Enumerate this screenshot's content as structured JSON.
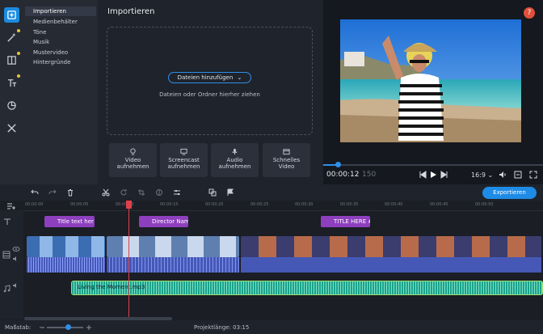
{
  "sidebar": {
    "items": [
      {
        "icon": "import-icon",
        "active": true
      },
      {
        "icon": "magic-wand-icon",
        "dot": true
      },
      {
        "icon": "transitions-icon",
        "dot": true
      },
      {
        "icon": "titles-icon",
        "dot": true
      },
      {
        "icon": "stickers-icon"
      },
      {
        "icon": "tools-icon"
      }
    ]
  },
  "categories": [
    "Importieren",
    "Medienbehälter",
    "Töne",
    "Musik",
    "Mustervideo",
    "Hintergründe"
  ],
  "import": {
    "title": "Importieren",
    "add_files": "Dateien hinzufügen",
    "drop_hint": "Dateien oder Ordner hierher ziehen",
    "record_buttons": [
      {
        "label": "Video\naufnehmen",
        "icon": "webcam-icon"
      },
      {
        "label": "Screencast\naufnehmen",
        "icon": "monitor-icon"
      },
      {
        "label": "Audio\naufnehmen",
        "icon": "microphone-icon"
      },
      {
        "label": "Schnelles\nVideo",
        "icon": "quick-video-icon"
      }
    ]
  },
  "preview": {
    "help": "?",
    "timecode": "00:00:12",
    "timecode_frames": "150",
    "aspect": "16:9",
    "progress": 0.07
  },
  "toolbar": {
    "export_label": "Exportieren"
  },
  "ruler": [
    "00:00:00",
    "00:00:05",
    "00:00:10",
    "00:00:15",
    "00:00:20",
    "00:00:25",
    "00:00:30",
    "00:00:35",
    "00:00:40",
    "00:00:45",
    "00:00:50"
  ],
  "timeline": {
    "title_clips": [
      "Title text her",
      "Director Nam",
      "TITLE HERE #"
    ],
    "music_clip": "Living the Moment.mp3"
  },
  "status": {
    "scale_label": "Maßstab:",
    "project_length": "Projektlänge: 03:15"
  },
  "colors": {
    "accent": "#1e8be6",
    "title_clip": "#8e3fbe",
    "audio_clip": "#4658b5",
    "music_clip": "#1aa38a",
    "playhead": "#e0404a"
  }
}
